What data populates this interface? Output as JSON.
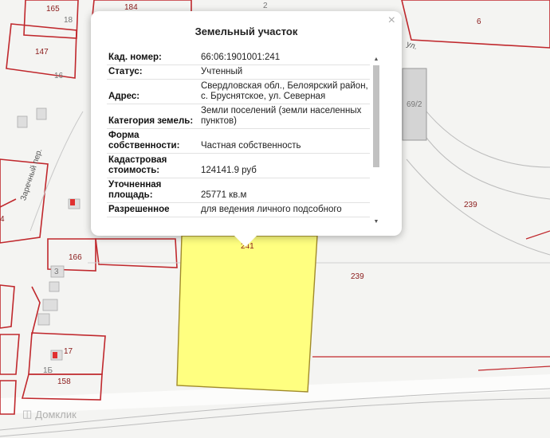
{
  "map": {
    "parcel_numbers": [
      "165",
      "184",
      "6",
      "147",
      "239",
      "241",
      "239",
      "166",
      "17",
      "158",
      "4"
    ],
    "house_numbers": [
      "18",
      "16",
      "3",
      "1Б",
      "69/2",
      "2"
    ],
    "streets": [
      "Заречный пер.",
      "ул."
    ],
    "watermark": "Домклик"
  },
  "popup": {
    "title": "Земельный участок",
    "close_label": "×",
    "rows": [
      {
        "key": "Кад. номер:",
        "value": "66:06:1901001:241"
      },
      {
        "key": "Статус:",
        "value": "Учтенный"
      },
      {
        "key": "Адрес:",
        "value": "Свердловская обл., Белоярский район, с. Бруснятское, ул. Северная"
      },
      {
        "key": "Категория земель:",
        "value": "Земли поселений (земли населенных пунктов)"
      },
      {
        "key": "Форма собственности:",
        "value": "Частная собственность"
      },
      {
        "key": "Кадастровая стоимость:",
        "value": "124141.9 руб"
      },
      {
        "key": "Уточненная площадь:",
        "value": "25771 кв.м"
      },
      {
        "key": "Разрешенное",
        "value": "для ведения личного подсобного"
      }
    ]
  },
  "colors": {
    "parcel_border": "#c0282d",
    "selected_fill": "#ffff80",
    "selected_border": "#a08a2a",
    "background": "#f4f4f2"
  }
}
